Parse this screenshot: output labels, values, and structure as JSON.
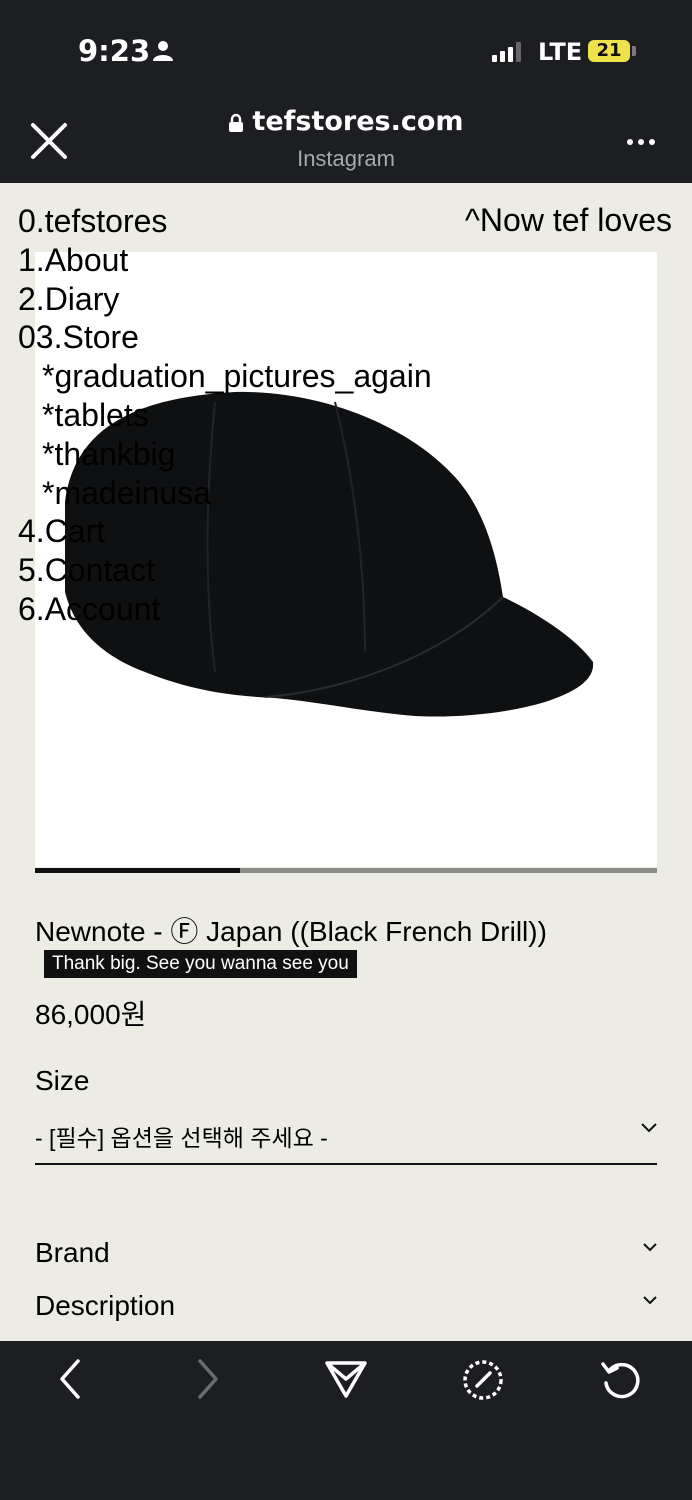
{
  "status_bar": {
    "time": "9:23",
    "network": "LTE",
    "battery": "21"
  },
  "browser": {
    "domain": "tefstores.com",
    "subtitle": "Instagram"
  },
  "site": {
    "top_right_link": "^Now tef loves",
    "menu": [
      {
        "label": "0.tefstores",
        "sub": false
      },
      {
        "label": "1.About",
        "sub": false
      },
      {
        "label": "2.Diary",
        "sub": false
      },
      {
        "label": "03.Store",
        "sub": false
      },
      {
        "label": "*graduation_pictures_again",
        "sub": true
      },
      {
        "label": "*tablets",
        "sub": true
      },
      {
        "label": "*thankbig",
        "sub": true
      },
      {
        "label": "*madeinusa",
        "sub": true
      },
      {
        "label": "4.Cart",
        "sub": false
      },
      {
        "label": "5.Contact",
        "sub": false
      },
      {
        "label": "6.Account",
        "sub": false
      }
    ]
  },
  "product": {
    "name": "Newnote - Ⓕ Japan ((Black French Drill))",
    "tag": "Thank big. See you wanna see you",
    "price": "86,000원",
    "image_progress": 0.33,
    "size_label": "Size",
    "size_select": "- [필수] 옵션을 선택해 주세요 -",
    "accordions": [
      {
        "label": "Brand"
      },
      {
        "label": "Description"
      }
    ]
  },
  "colors": {
    "background": "#ecebe4",
    "chrome": "#1c1e22",
    "battery": "#efe14a"
  },
  "icons": [
    "person-icon",
    "signal-icon",
    "lock-icon",
    "close-icon",
    "more-icon",
    "back-icon",
    "forward-icon",
    "share-icon",
    "compass-icon",
    "reload-icon",
    "chevron-down-icon"
  ]
}
